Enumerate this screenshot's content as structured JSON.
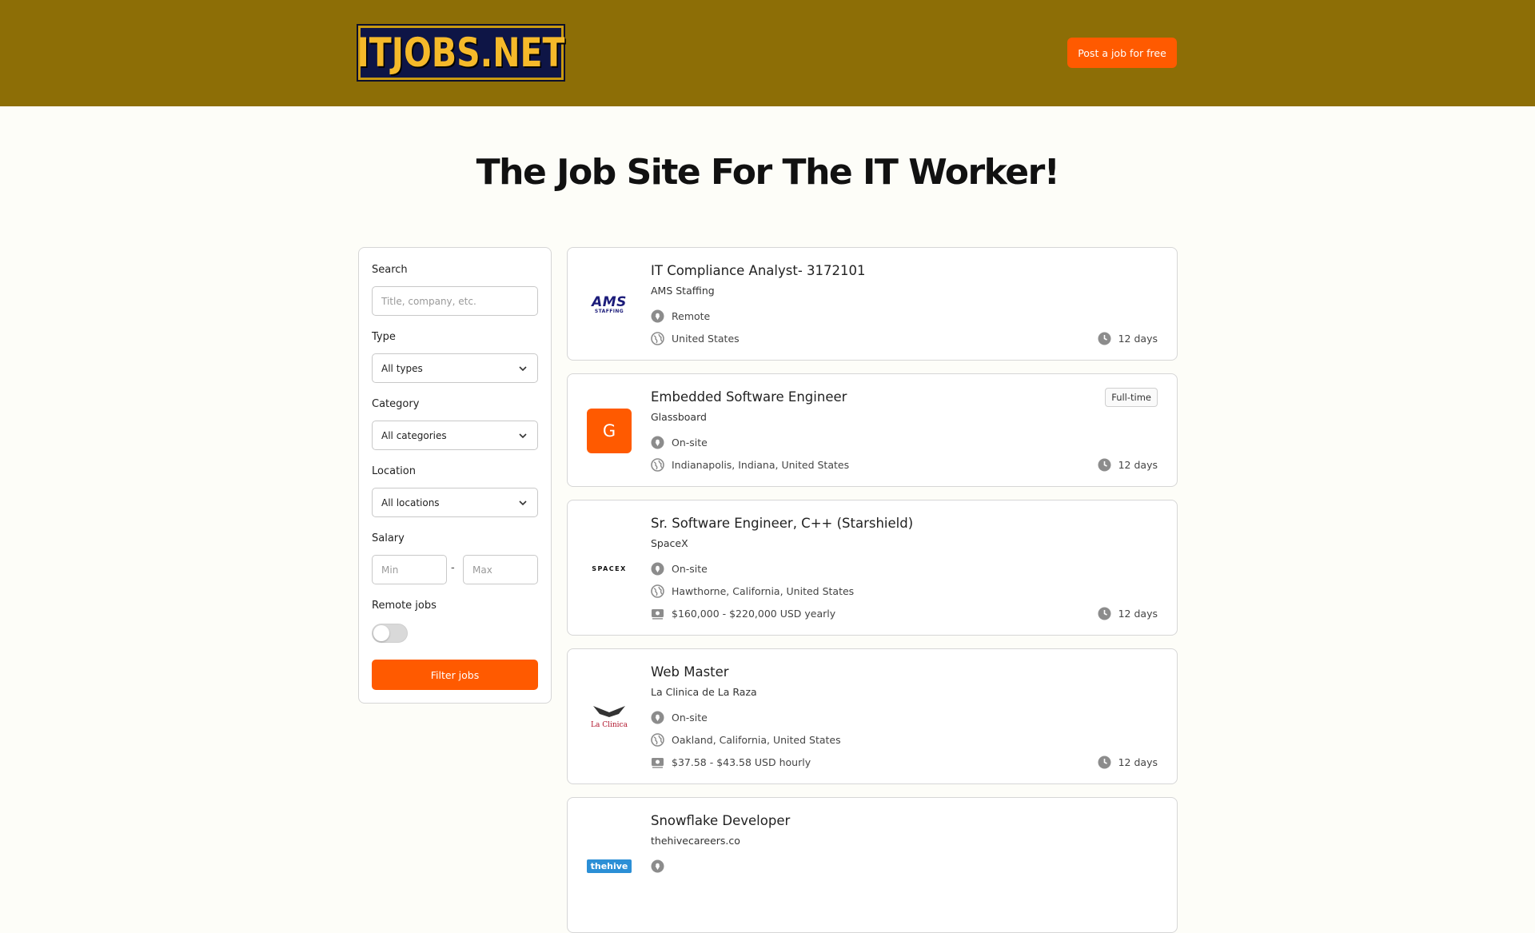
{
  "header": {
    "logo_text": "ITJOBS.NET",
    "post_job_label": "Post a job for free"
  },
  "hero": {
    "title": "The Job Site For The IT Worker!"
  },
  "filters": {
    "search_label": "Search",
    "search_placeholder": "Title, company, etc.",
    "type_label": "Type",
    "type_value": "All types",
    "category_label": "Category",
    "category_value": "All categories",
    "location_label": "Location",
    "location_value": "All locations",
    "salary_label": "Salary",
    "salary_min_placeholder": "Min",
    "salary_separator": "-",
    "salary_max_placeholder": "Max",
    "remote_label": "Remote jobs",
    "remote_enabled": false,
    "filter_button_label": "Filter jobs"
  },
  "jobs": [
    {
      "title": "IT Compliance Analyst- 3172101",
      "company": "AMS Staffing",
      "work_mode": "Remote",
      "location": "United States",
      "salary": "",
      "age": "12 days",
      "badge": "",
      "logo_text_1": "AMS",
      "logo_text_2": "STAFFING"
    },
    {
      "title": "Embedded Software Engineer",
      "company": "Glassboard",
      "work_mode": "On-site",
      "location": "Indianapolis, Indiana, United States",
      "salary": "",
      "age": "12 days",
      "badge": "Full-time",
      "logo_text_1": "G"
    },
    {
      "title": "Sr. Software Engineer, C++ (Starshield)",
      "company": "SpaceX",
      "work_mode": "On-site",
      "location": "Hawthorne, California, United States",
      "salary": "$160,000 - $220,000 USD yearly",
      "age": "12 days",
      "badge": "",
      "logo_text_1": "SPACEX"
    },
    {
      "title": "Web Master",
      "company": "La Clinica de La Raza",
      "work_mode": "On-site",
      "location": "Oakland, California, United States",
      "salary": "$37.58 - $43.58 USD hourly",
      "age": "12 days",
      "badge": "",
      "logo_text_1": "La Clinica"
    },
    {
      "title": "Snowflake Developer",
      "company": "thehivecareers.co",
      "work_mode": "",
      "location": "",
      "salary": "",
      "age": "",
      "badge": "",
      "logo_text_1": "thehive"
    }
  ],
  "colors": {
    "header_bg": "#8d6e06",
    "accent": "#ff5a00",
    "logo_bg": "#0e1546",
    "logo_text": "#f5b92a"
  },
  "icons": {
    "location": "map-pin-icon",
    "region": "globe-icon",
    "salary": "money-icon",
    "age": "clock-icon",
    "dropdown": "chevron-down-icon"
  }
}
